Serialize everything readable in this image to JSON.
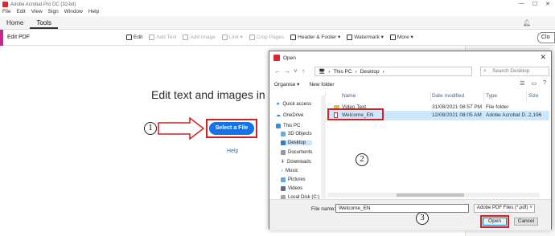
{
  "window": {
    "title": "Adobe Acrobat Pro DC (32-bit)",
    "controls": [
      "—",
      "☐",
      "✕"
    ]
  },
  "menu": [
    "File",
    "Edit",
    "View",
    "Sign",
    "Window",
    "Help"
  ],
  "tabs": [
    "Home",
    "Tools"
  ],
  "toolbar": {
    "mode_label": "Edit PDF",
    "tools": [
      {
        "label": "Edit",
        "enabled": true
      },
      {
        "label": "Add Text",
        "enabled": false
      },
      {
        "label": "Add Image",
        "enabled": false
      },
      {
        "label": "Link ▾",
        "enabled": false
      },
      {
        "label": "Crop Pages",
        "enabled": false
      },
      {
        "label": "Header & Footer ▾",
        "enabled": true
      },
      {
        "label": "Watermark ▾",
        "enabled": true
      },
      {
        "label": "More ▾",
        "enabled": true
      }
    ],
    "close_label": "Clo"
  },
  "main": {
    "headline": "Edit text and images in a",
    "select_button": "Select a File",
    "help_link": "Help"
  },
  "annotations": {
    "step1": "1",
    "step2": "2",
    "step3": "3"
  },
  "dialog": {
    "title": "Open",
    "path": [
      "This PC",
      "Desktop"
    ],
    "search_placeholder": "Search Desktop",
    "organise": "Organise ▾",
    "new_folder": "New folder",
    "nav_items": [
      "Quick access",
      "OneDrive",
      "This PC",
      "3D Objects",
      "Desktop",
      "Documents",
      "Downloads",
      "Music",
      "Pictures",
      "Videos",
      "Local Disk (C:)"
    ],
    "columns": [
      "Name",
      "Date modified",
      "Type",
      "Size"
    ],
    "files": [
      {
        "name": "Video Text",
        "date": "31/08/2021 08:57 PM",
        "type": "File folder",
        "size": "",
        "kind": "folder"
      },
      {
        "name": "Welcome_EN",
        "date": "12/08/2021 08:05 AM",
        "type": "Adobe Acrobat D...",
        "size": "2,196",
        "kind": "pdf"
      }
    ],
    "file_name_label": "File name:",
    "file_name_value": "Welcome_EN",
    "file_type": "Adobe PDF Files (*.pdf)",
    "open_label": "Open",
    "cancel_label": "Cancel"
  },
  "colors": {
    "accent": "#1473e6",
    "annotation_red": "#d42020",
    "edit_stripe": "#c9268f",
    "selection": "#cce8ff"
  }
}
